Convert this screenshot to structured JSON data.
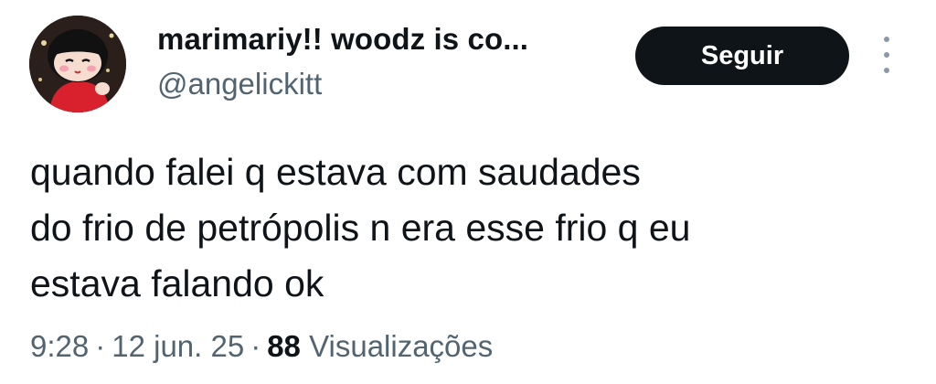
{
  "author": {
    "display_name": "marimariy!! woodz is co...",
    "handle": "@angelickitt",
    "avatar_icon": "cartoon-doll-avatar"
  },
  "actions": {
    "follow_label": "Seguir",
    "more_icon": "vertical-dots-icon"
  },
  "tweet": {
    "lines": [
      "quando falei q estava com saudades",
      "do frio de petrópolis n era esse frio q eu",
      "estava falando ok"
    ]
  },
  "meta": {
    "time": "9:28",
    "separator": "·",
    "date": "12 jun. 25",
    "views_count": "88",
    "views_label": "Visualizações"
  },
  "colors": {
    "primary_text": "#0f1419",
    "secondary_text": "#536471",
    "button_bg": "#0f1419",
    "button_text": "#ffffff"
  }
}
